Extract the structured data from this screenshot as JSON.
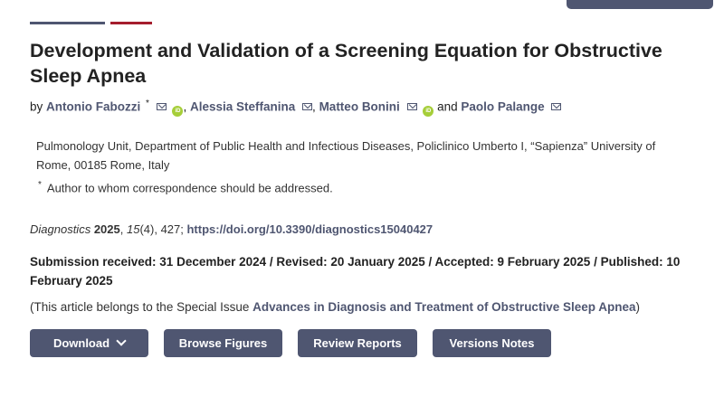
{
  "article": {
    "title": "Development and Validation of a Screening Equation for Obstructive Sleep Apnea",
    "by": "by",
    "authors": [
      {
        "name": "Antonio Fabozzi",
        "corresponding_mark": "*"
      },
      {
        "name": "Alessia Steffanina"
      },
      {
        "name": "Matteo Bonini"
      },
      {
        "name": "Paolo Palange"
      }
    ],
    "author_sep_1": ", ",
    "author_sep_2": ", ",
    "author_sep_last": " and ",
    "orcid_label": "iD",
    "affiliation": "Pulmonology Unit, Department of Public Health and Infectious Diseases, Policlinico Umberto I, “Sapienza” University of Rome, 00185 Rome, Italy",
    "correspondence_mark": "*",
    "correspondence_note": "Author to whom correspondence should be addressed.",
    "citation": {
      "journal": "Diagnostics",
      "year": "2025",
      "volume": "15",
      "issue_pages": "(4), 427; ",
      "doi": "https://doi.org/10.3390/diagnostics15040427"
    },
    "dates": "Submission received: 31 December 2024 / Revised: 20 January 2025 / Accepted: 9 February 2025 / Published: 10 February 2025",
    "special_issue": {
      "prefix": "(This article belongs to the Special Issue ",
      "link": "Advances in Diagnosis and Treatment of Obstructive Sleep Apnea",
      "suffix": ")"
    }
  },
  "actions": {
    "download": "Download",
    "browse_figures": "Browse Figures",
    "review_reports": "Review Reports",
    "versions_notes": "Versions Notes"
  },
  "colors": {
    "accent_blue": "#4f5671",
    "accent_red": "#a51d2d",
    "orcid_green": "#a6ce39"
  },
  "icons": [
    "mail-icon",
    "orcid-icon",
    "chevron-down-icon"
  ]
}
